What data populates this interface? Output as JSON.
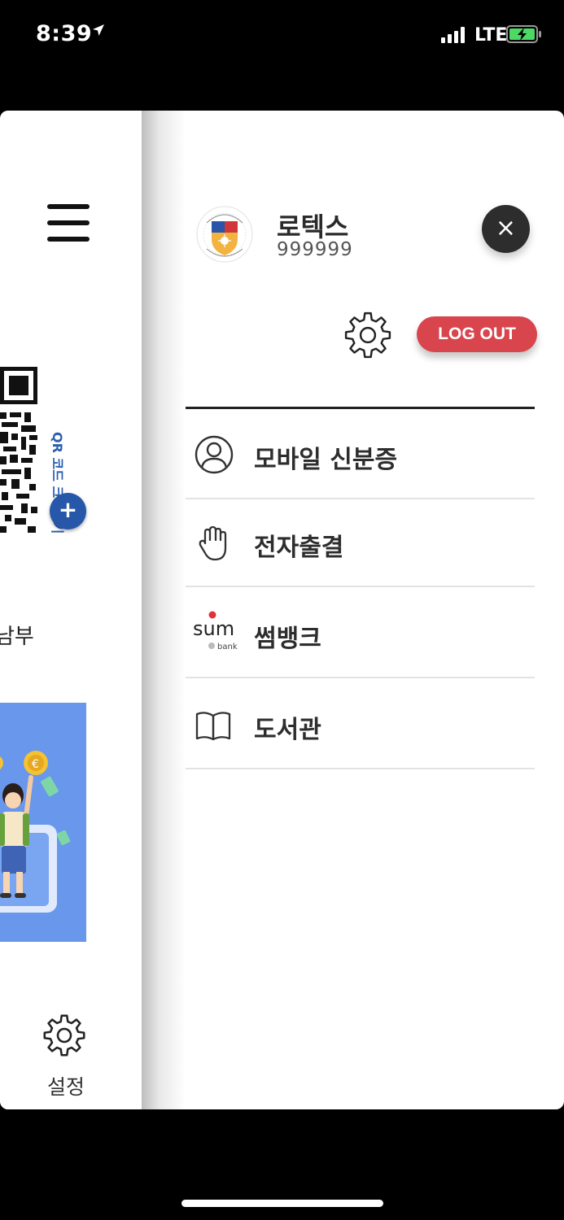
{
  "status_bar": {
    "time": "8:39",
    "network": "LTE"
  },
  "left_pane": {
    "qr_label": "QR 코드 크게보기",
    "qr_plus": "+",
    "cut_text": "남부",
    "settings_label": "설정"
  },
  "drawer": {
    "user_name": "로텍스",
    "user_id": "999999",
    "close_symbol": "×",
    "logout_label": "LOG OUT",
    "menu": [
      {
        "label": "모바일 신분증",
        "icon": "person-circle-icon"
      },
      {
        "label": "전자출결",
        "icon": "hand-icon"
      },
      {
        "label": "썸뱅크",
        "icon": "sum-bank-logo-icon"
      },
      {
        "label": "도서관",
        "icon": "open-book-icon"
      }
    ],
    "sum_bank_text": "sum",
    "sum_bank_sub": "bank"
  },
  "colors": {
    "logout": "#d8454d",
    "qr_label": "#2b5fb0",
    "plus_button": "#2757a8",
    "banner": "#6897ec",
    "close_button": "#2d2d2d"
  }
}
